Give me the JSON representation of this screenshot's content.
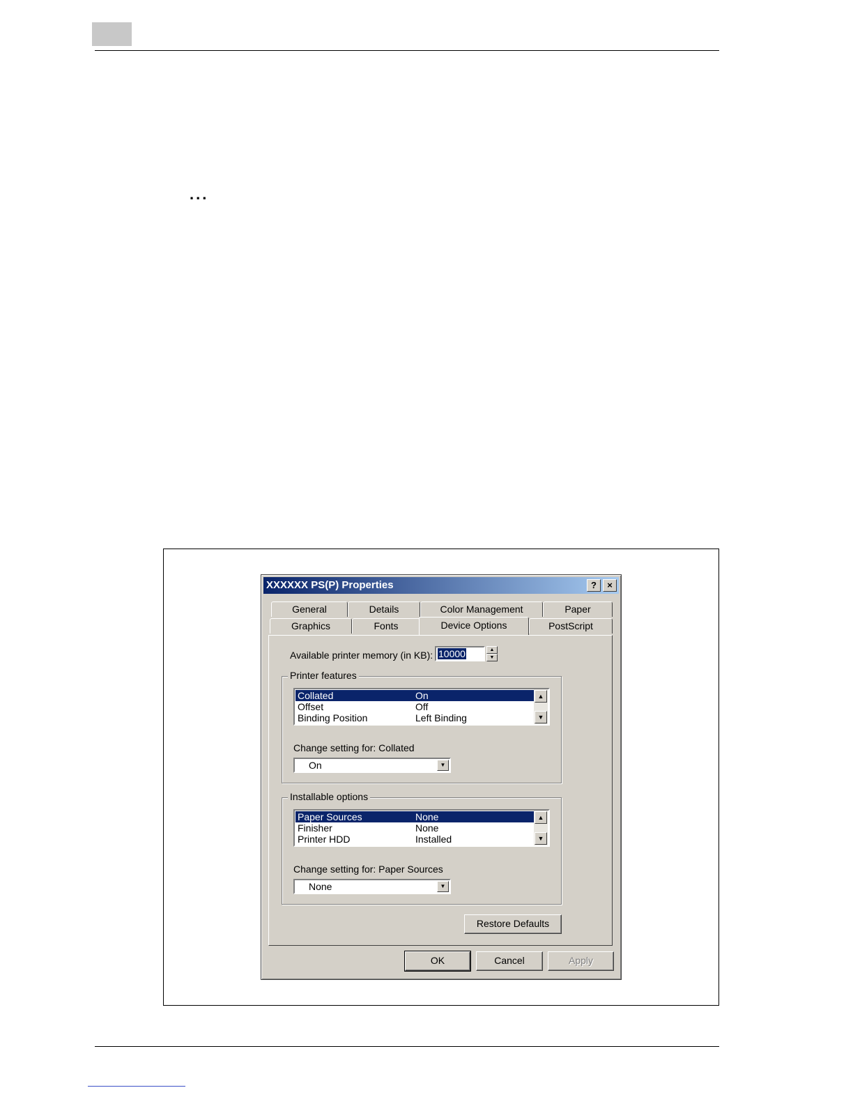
{
  "page": {
    "ellipsis": "..."
  },
  "dialog": {
    "title": "XXXXXX PS(P) Properties",
    "help_button": "?",
    "close_button": "×",
    "tabs_back_row": [
      "General",
      "Details",
      "Color Management",
      "Paper"
    ],
    "tabs_front_row": [
      "Graphics",
      "Fonts",
      "Device Options",
      "PostScript"
    ],
    "active_tab": "Device Options",
    "memory": {
      "label": "Available printer memory (in KB):",
      "value": "10000"
    },
    "printer_features": {
      "label": "Printer features",
      "rows": [
        {
          "name": "Collated",
          "value": "On",
          "selected": true
        },
        {
          "name": "Offset",
          "value": "Off",
          "selected": false
        },
        {
          "name": "Binding Position",
          "value": "Left Binding",
          "selected": false
        }
      ],
      "change_label": "Change setting for:  Collated",
      "combo_value": "On"
    },
    "installable_options": {
      "label": "Installable options",
      "rows": [
        {
          "name": "Paper Sources",
          "value": "None",
          "selected": true
        },
        {
          "name": "Finisher",
          "value": "None",
          "selected": false
        },
        {
          "name": "Printer HDD",
          "value": "Installed",
          "selected": false
        }
      ],
      "change_label": "Change setting for:  Paper Sources",
      "combo_value": "None"
    },
    "buttons": {
      "restore_defaults": "Restore Defaults",
      "ok": "OK",
      "cancel": "Cancel",
      "apply": "Apply"
    }
  }
}
